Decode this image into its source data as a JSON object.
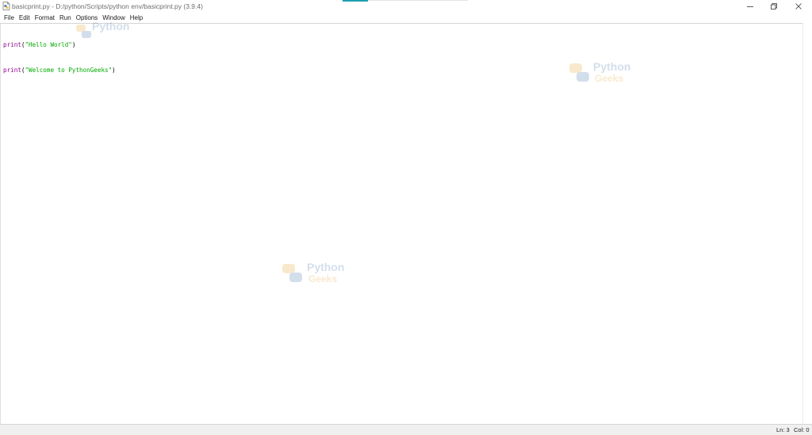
{
  "window": {
    "title": "basicprint.py - D:/python/Scripts/python env/basicprint.py (3.9.4)",
    "controls": {
      "minimize_icon": "minimize-icon",
      "maximize_icon": "restore-icon",
      "close_icon": "close-icon"
    }
  },
  "menubar": {
    "items": [
      "File",
      "Edit",
      "Format",
      "Run",
      "Options",
      "Window",
      "Help"
    ]
  },
  "editor": {
    "lines": [
      {
        "func": "print",
        "open": "(",
        "string": "\"Hello World\"",
        "close": ")"
      },
      {
        "func": "print",
        "open": "(",
        "string": "\"Welcome to PythonGeeks\"",
        "close": ")"
      }
    ],
    "colors": {
      "builtin": "#900090",
      "string": "#00aa00",
      "punctuation": "#000000"
    }
  },
  "statusbar": {
    "line": "Ln: 3",
    "column": "Col: 0"
  },
  "watermarks": [
    {
      "line1": "Python",
      "line2": "Geeks"
    },
    {
      "line1": "Python",
      "line2": "Geeks"
    },
    {
      "line1": "Python",
      "line2": ""
    }
  ]
}
